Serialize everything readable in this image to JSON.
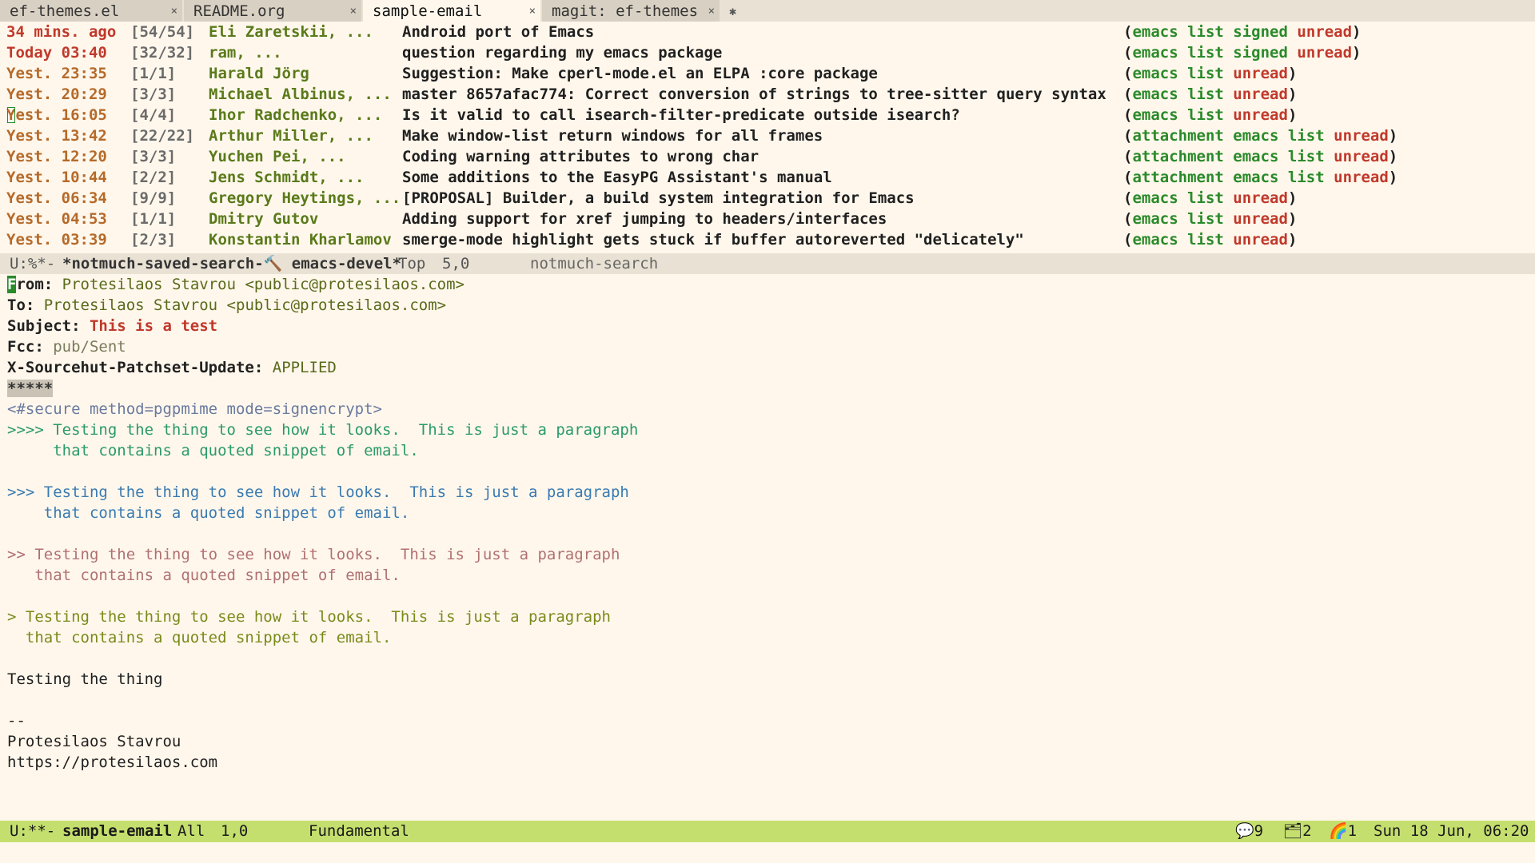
{
  "tabs": [
    {
      "label": "ef-themes.el",
      "close": "×",
      "active": false,
      "width": 228
    },
    {
      "label": "README.org",
      "close": "×",
      "active": false,
      "width": 222
    },
    {
      "label": "sample-email",
      "close": "×",
      "active": true,
      "width": 222
    },
    {
      "label": "magit: ef-themes",
      "close": "×",
      "active": false,
      "width": 222
    }
  ],
  "new_tab_glyph": "✱",
  "search_results": [
    {
      "date": "34 mins. ago",
      "count": "[54/54]",
      "authors": "Eli Zaretskii, ...",
      "subject": "Android port of Emacs",
      "tags": [
        [
          "(",
          ""
        ],
        [
          "emacs list signed",
          "g"
        ],
        [
          " ",
          ""
        ],
        [
          "unread",
          "r"
        ],
        [
          ")",
          ""
        ]
      ]
    },
    {
      "date": "Today 03:40",
      "count": "[32/32]",
      "authors": "ram, ...",
      "subject": "question regarding my emacs package",
      "tags": [
        [
          "(",
          ""
        ],
        [
          "emacs list signed",
          "g"
        ],
        [
          " ",
          ""
        ],
        [
          "unread",
          "r"
        ],
        [
          ")",
          ""
        ]
      ]
    },
    {
      "date": "Yest. 23:35",
      "count": "[1/1]",
      "authors": "Harald Jörg",
      "subject": "Suggestion: Make cperl-mode.el an ELPA :core package",
      "tags": [
        [
          "(",
          ""
        ],
        [
          "emacs list",
          "g"
        ],
        [
          " ",
          ""
        ],
        [
          "unread",
          "r"
        ],
        [
          ")",
          ""
        ]
      ]
    },
    {
      "date": "Yest. 20:29",
      "count": "[3/3]",
      "authors": "Michael Albinus, ...",
      "subject": "master 8657afac774: Correct conversion of strings to tree-sitter query syntax",
      "tags": [
        [
          "(",
          ""
        ],
        [
          "emacs list",
          "g"
        ],
        [
          " ",
          ""
        ],
        [
          "unread",
          "r"
        ],
        [
          ")",
          ""
        ]
      ]
    },
    {
      "date": "Yest. 16:05",
      "count": "[4/4]",
      "authors": "Ihor Radchenko, ...",
      "subject": "Is it valid to call isearch-filter-predicate outside isearch?",
      "tags": [
        [
          "(",
          ""
        ],
        [
          "emacs list",
          "g"
        ],
        [
          " ",
          ""
        ],
        [
          "unread",
          "r"
        ],
        [
          ")",
          ""
        ]
      ]
    },
    {
      "date": "Yest. 13:42",
      "count": "[22/22]",
      "authors": "Arthur Miller, ...",
      "subject": "Make window-list return windows for all frames",
      "tags": [
        [
          "(",
          ""
        ],
        [
          "attachment emacs list",
          "g"
        ],
        [
          " ",
          ""
        ],
        [
          "unread",
          "r"
        ],
        [
          ")",
          ""
        ]
      ]
    },
    {
      "date": "Yest. 12:20",
      "count": "[3/3]",
      "authors": "Yuchen Pei, ...",
      "subject": "Coding warning attributes to wrong char",
      "tags": [
        [
          "(",
          ""
        ],
        [
          "attachment emacs list",
          "g"
        ],
        [
          " ",
          ""
        ],
        [
          "unread",
          "r"
        ],
        [
          ")",
          ""
        ]
      ]
    },
    {
      "date": "Yest. 10:44",
      "count": "[2/2]",
      "authors": "Jens Schmidt, ...",
      "subject": "Some additions to the EasyPG Assistant's manual",
      "tags": [
        [
          "(",
          ""
        ],
        [
          "attachment emacs list",
          "g"
        ],
        [
          " ",
          ""
        ],
        [
          "unread",
          "r"
        ],
        [
          ")",
          ""
        ]
      ]
    },
    {
      "date": "Yest. 06:34",
      "count": "[9/9]",
      "authors": "Gregory Heytings, ...",
      "subject": "[PROPOSAL] Builder, a build system integration for Emacs",
      "tags": [
        [
          "(",
          ""
        ],
        [
          "emacs list",
          "g"
        ],
        [
          " ",
          ""
        ],
        [
          "unread",
          "r"
        ],
        [
          ")",
          ""
        ]
      ]
    },
    {
      "date": "Yest. 04:53",
      "count": "[1/1]",
      "authors": "Dmitry Gutov",
      "subject": "Adding support for xref jumping to headers/interfaces",
      "tags": [
        [
          "(",
          ""
        ],
        [
          "emacs list",
          "g"
        ],
        [
          " ",
          ""
        ],
        [
          "unread",
          "r"
        ],
        [
          ")",
          ""
        ]
      ]
    },
    {
      "date": "Yest. 03:39",
      "count": "[2/3]",
      "authors": "Konstantin Kharlamov",
      "subject": "smerge-mode highlight gets stuck if buffer autoreverted \"delicately\"",
      "tags": [
        [
          "(",
          ""
        ],
        [
          "emacs list",
          "g"
        ],
        [
          " ",
          ""
        ],
        [
          "unread",
          "r"
        ],
        [
          ")",
          ""
        ]
      ]
    }
  ],
  "search_modeline": {
    "status": "U:%*-",
    "buffer": "*notmuch-saved-search-🔨 emacs-devel*",
    "position": "Top",
    "linecol": "5,0",
    "mode": "notmuch-search"
  },
  "message": {
    "from_label": "From:",
    "from_value": "Protesilaos Stavrou <public@protesilaos.com>",
    "to_label": "To:",
    "to_value": "Protesilaos Stavrou <public@protesilaos.com>",
    "subject_label": "Subject:",
    "subject_value": "This is a test",
    "fcc_label": "Fcc:",
    "fcc_value": "pub/Sent",
    "xsh_label": "X-Sourcehut-Patchset-Update:",
    "xsh_value": "APPLIED",
    "separator": "*****",
    "secure": "<#secure method=pgpmime mode=signencrypt>",
    "q4_a": ">>>> Testing the thing to see how it looks.  This is just a paragraph",
    "q4_b": "     that contains a quoted snippet of email.",
    "q3_a": ">>> Testing the thing to see how it looks.  This is just a paragraph",
    "q3_b": "    that contains a quoted snippet of email.",
    "q2_a": ">> Testing the thing to see how it looks.  This is just a paragraph",
    "q2_b": "   that contains a quoted snippet of email.",
    "q1_a": "> Testing the thing to see how it looks.  This is just a paragraph",
    "q1_b": "  that contains a quoted snippet of email.",
    "body": "Testing the thing",
    "sig_sep": "--",
    "sig_name": "Protesilaos Stavrou",
    "sig_url": "https://protesilaos.com"
  },
  "active_modeline": {
    "status": "U:**-",
    "buffer": "sample-email",
    "position": "All",
    "linecol": "1,0",
    "mode": "Fundamental",
    "chat": "💬9",
    "folder": "🗂2",
    "rainbow": "🌈1",
    "datetime": "Sun 18 Jun, 06:20"
  }
}
